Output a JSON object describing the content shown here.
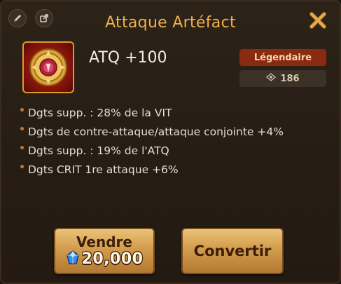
{
  "header": {
    "title": "Attaque Artéfact",
    "edit_icon": "pencil-icon",
    "share_icon": "share-icon",
    "close_icon": "close-x-icon"
  },
  "artifact": {
    "icon": "artifact-emblem-icon",
    "main_stat": "ATQ +100",
    "rarity": "Légendaire",
    "power_icon": "eye-diamond-icon",
    "power": "186"
  },
  "substats": [
    "Dgts supp. : 28% de la VIT",
    "Dgts de contre-attaque/attaque conjointe +4%",
    "Dgts supp. : 19% de l'ATQ",
    "Dgts CRIT 1re attaque +6%"
  ],
  "actions": {
    "sell_label": "Vendre",
    "sell_price": "20,000",
    "sell_currency_icon": "crystal-icon",
    "convert_label": "Convertir"
  },
  "colors": {
    "title": "#f0b04a",
    "rarity_bg": "#8a2a12",
    "button_gold": "#d39c4c"
  }
}
